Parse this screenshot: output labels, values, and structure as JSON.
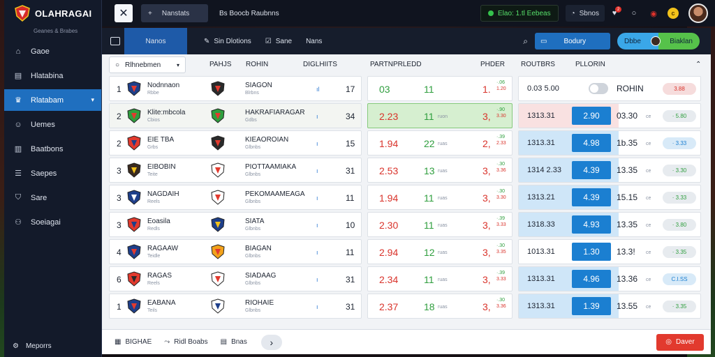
{
  "brand": {
    "name": "OLAHRAGAI",
    "subtitle": "Geanes & Brabes"
  },
  "sidebar": {
    "items": [
      {
        "label": "Gaoe",
        "icon": "home-icon",
        "active": false
      },
      {
        "label": "Hlatabina",
        "icon": "document-icon",
        "active": false
      },
      {
        "label": "Rlatabam",
        "icon": "trophy-icon",
        "active": true
      },
      {
        "label": "Uemes",
        "icon": "users-icon",
        "active": false
      },
      {
        "label": "Baatbons",
        "icon": "chart-icon",
        "active": false
      },
      {
        "label": "Saepes",
        "icon": "list-icon",
        "active": false
      },
      {
        "label": "Sare",
        "icon": "shield-icon",
        "active": false
      },
      {
        "label": "Soeiagai",
        "icon": "group-icon",
        "active": false
      }
    ],
    "footer_label": "Meporrs"
  },
  "topbar": {
    "tab_label": "Nanstats",
    "title": "Bs Boocb Raubnns",
    "live_label": "Elao: 1.tl Eebeas",
    "notif_label": "Sbnos",
    "badge_count": "2",
    "coin_label": "c"
  },
  "subnav": {
    "active_tab": "Nanos",
    "items": [
      "Sin  Dlotions",
      "Sane",
      "Nans"
    ],
    "search_placeholder": "Bodury",
    "user_left": "Dbbe",
    "user_right": "Biaklan"
  },
  "table": {
    "filter_label": "Rlhnebmen",
    "headers": [
      "PAHJS",
      "ROHIN",
      "DIGLHIITS",
      "PARTNPRLEDD",
      "PHDER",
      "ROUTBRS",
      "PLLORIN"
    ],
    "rows": [
      {
        "rank": "1",
        "team1": "Nodnnaon",
        "team1_sub": "Rbbe",
        "team2": "SIAGON",
        "team2_sub": "Blrbns",
        "spark": "ıl",
        "pts": "17",
        "o1": "03",
        "o1_green": true,
        "o2": "11",
        "o2_sub": "",
        "o3": "1.",
        "o3_up": "·.06",
        "o3_down": "1.20",
        "score": "0.03 5.00",
        "price": "",
        "toggle": true,
        "rv": "ROHIN",
        "rv_sub": "",
        "pill": "3.88",
        "pill_style": "r",
        "style": "plain"
      },
      {
        "rank": "2",
        "team1": "Klite:mbcola",
        "team1_sub": "Cbios",
        "team2": "HAKRAFIARAGAR",
        "team2_sub": "Gdbs",
        "spark": "ı",
        "pts": "34",
        "o1": "2.23",
        "o1_green": false,
        "o2": "11",
        "o2_sub": "ruon",
        "o3": "3,",
        "o3_up": "·.90",
        "o3_down": "3.30",
        "score": "1313.31",
        "price": "2.90",
        "toggle": false,
        "rv": "03.30",
        "rv_sub": "ce",
        "pill": "· 5.80",
        "pill_style": "",
        "style": "hl"
      },
      {
        "rank": "2",
        "team1": "EIE TBA",
        "team1_sub": "Grbs",
        "team2": "KIEAOROIAN",
        "team2_sub": "Glbnbs",
        "spark": "ı",
        "pts": "15",
        "o1": "1.94",
        "o1_green": false,
        "o2": "22",
        "o2_sub": "ruas",
        "o3": "2,",
        "o3_up": "·.39",
        "o3_down": "2.33",
        "score": "1313.31",
        "price": "4.98",
        "toggle": false,
        "rv": "1b.35",
        "rv_sub": "ce",
        "pill": "· 3.33",
        "pill_style": "b",
        "style": "blue"
      },
      {
        "rank": "3",
        "team1": "EIBOBIN",
        "team1_sub": "Teite",
        "team2": "PIOTTAAMIAKA",
        "team2_sub": "Glbnbs",
        "spark": "ı",
        "pts": "31",
        "o1": "2.53",
        "o1_green": false,
        "o2": "13",
        "o2_sub": "ruas",
        "o3": "3,",
        "o3_up": "·.30",
        "o3_down": "3.36",
        "score": "1314 2.33",
        "price": "4.39",
        "toggle": false,
        "rv": "13.35",
        "rv_sub": "ce",
        "pill": "· 3.30",
        "pill_style": "",
        "style": "blue"
      },
      {
        "rank": "3",
        "team1": "NAGDAIH",
        "team1_sub": "Reels",
        "team2": "PEKOMAAMEAGA",
        "team2_sub": "Glbnbs",
        "spark": "ı",
        "pts": "11",
        "o1": "1.94",
        "o1_green": false,
        "o2": "11",
        "o2_sub": "ruas",
        "o3": "3,",
        "o3_up": "·.30",
        "o3_down": "3.30",
        "score": "1313.21",
        "price": "4.39",
        "toggle": false,
        "rv": "15.15",
        "rv_sub": "ce",
        "pill": "· 3.33",
        "pill_style": "",
        "style": "blue"
      },
      {
        "rank": "3",
        "team1": "Eoasila",
        "team1_sub": "Redls",
        "team2": "SIATA",
        "team2_sub": "Glbnbs",
        "spark": "ı",
        "pts": "10",
        "o1": "2.30",
        "o1_green": false,
        "o2": "11",
        "o2_sub": "ruas",
        "o3": "3,",
        "o3_up": "·.39",
        "o3_down": "3.33",
        "score": "1318.33",
        "price": "4.93",
        "toggle": false,
        "rv": "13.35",
        "rv_sub": "ce",
        "pill": "· 3.80",
        "pill_style": "",
        "style": "blue"
      },
      {
        "rank": "4",
        "team1": "RAGAAW",
        "team1_sub": "Teidle",
        "team2": "BIAGAN",
        "team2_sub": "Glbnbs",
        "spark": "ı",
        "pts": "11",
        "o1": "2.94",
        "o1_green": false,
        "o2": "12",
        "o2_sub": "ruas",
        "o3": "3,",
        "o3_up": "·.30",
        "o3_down": "3.35",
        "score": "1013.31",
        "price": "1.30",
        "toggle": false,
        "rv": "13.3!",
        "rv_sub": "ce",
        "pill": "· 3.35",
        "pill_style": "",
        "style": "plain"
      },
      {
        "rank": "6",
        "team1": "RAGAS",
        "team1_sub": "Reels",
        "team2": "SIADAAG",
        "team2_sub": "Glbnbs",
        "spark": "ı",
        "pts": "31",
        "o1": "2.34",
        "o1_green": false,
        "o2": "11",
        "o2_sub": "ruas",
        "o3": "3,",
        "o3_up": "·.39",
        "o3_down": "3.33",
        "score": "1313.31",
        "price": "4.96",
        "toggle": false,
        "rv": "13.36",
        "rv_sub": "ce",
        "pill": "C.I.SS",
        "pill_style": "b",
        "style": "blue"
      },
      {
        "rank": "1",
        "team1": "EABANA",
        "team1_sub": "Teils",
        "team2": "RIOHAIE",
        "team2_sub": "Glbnbs",
        "spark": "ı",
        "pts": "31",
        "o1": "2.37",
        "o1_green": false,
        "o2": "18",
        "o2_sub": "ruas",
        "o3": "3,",
        "o3_up": "·.30",
        "o3_down": "3.36",
        "score": "1313.31",
        "price": "1.39",
        "toggle": false,
        "rv": "13.55",
        "rv_sub": "ce",
        "pill": "· 3.35",
        "pill_style": "",
        "style": "blue"
      }
    ]
  },
  "footer": {
    "item1": "BIGHAE",
    "item2": "Ridl Boabs",
    "item3": "Bnas",
    "button_label": "Daver"
  },
  "colors": {
    "accent": "#1f6fbf",
    "green": "#2f9e3e",
    "red": "#d9332b",
    "danger": "#e23a2e"
  }
}
